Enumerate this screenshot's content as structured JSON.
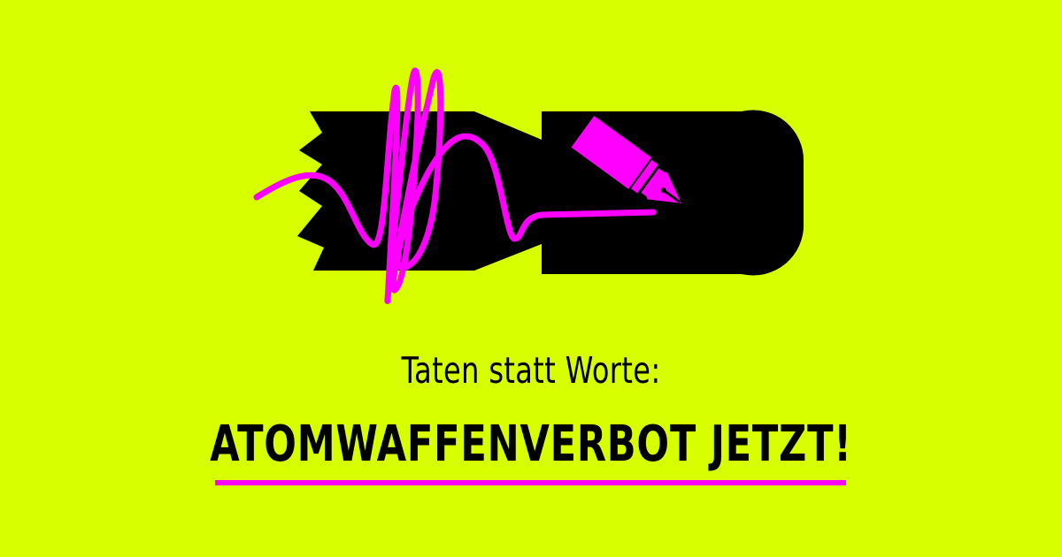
{
  "colors": {
    "background": "#d8ff00",
    "ink": "#000000",
    "accent": "#ff00ff"
  },
  "illustration": {
    "icon": "bomb-with-pen-scribble"
  },
  "text": {
    "subtitle": "Taten statt Worte:",
    "headline": "ATOMWAFFENVERBOT JETZT!"
  }
}
